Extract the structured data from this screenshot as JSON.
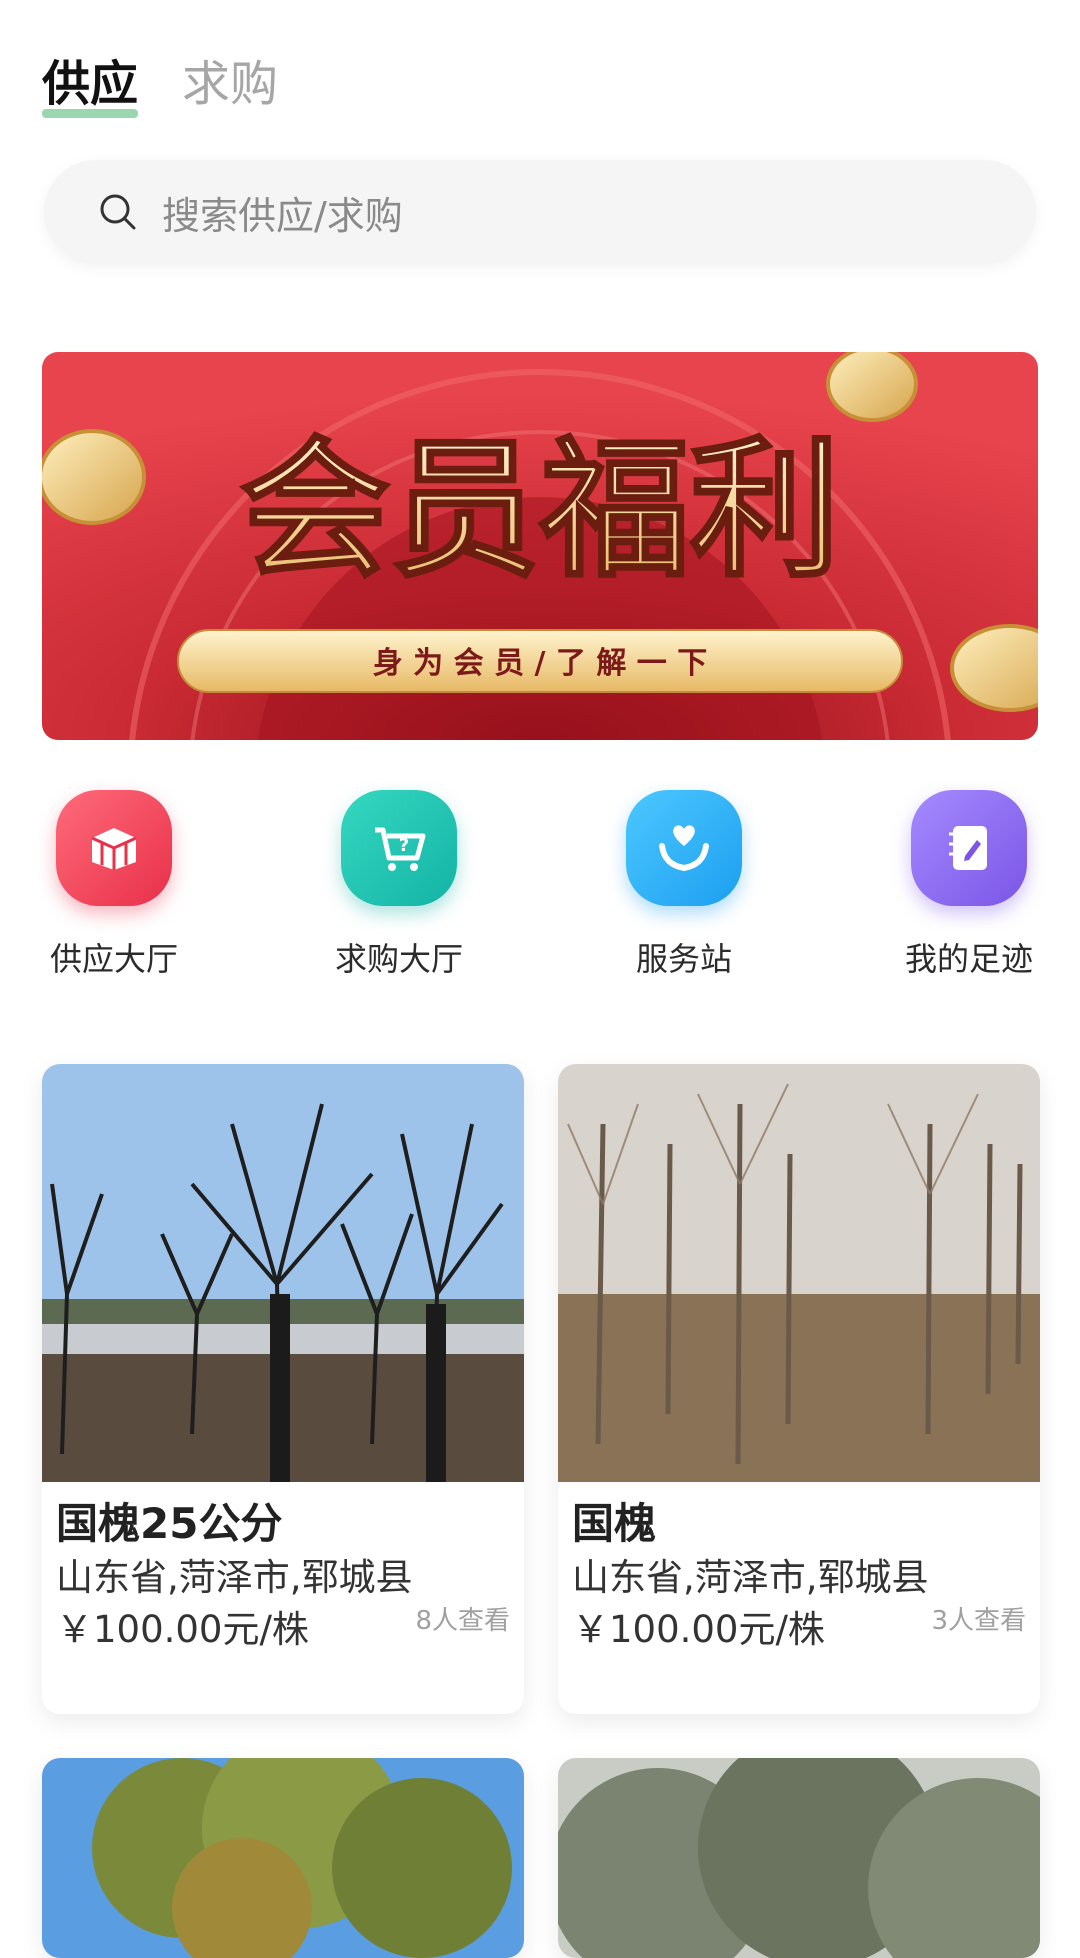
{
  "tabs": [
    {
      "label": "供应",
      "active": true
    },
    {
      "label": "求购",
      "active": false
    }
  ],
  "search": {
    "placeholder": "搜索供应/求购"
  },
  "banner": {
    "title": "会员福利",
    "subtitle": "身 为 会 员 / 了 解 一 下"
  },
  "quick_links": [
    {
      "label": "供应大厅",
      "icon": "supply-hall-icon",
      "color": "#f0485a"
    },
    {
      "label": "求购大厅",
      "icon": "cart-question-icon",
      "color": "#1fc7b0"
    },
    {
      "label": "服务站",
      "icon": "heart-hands-icon",
      "color": "#2fb4f5"
    },
    {
      "label": "我的足迹",
      "icon": "notebook-pen-icon",
      "color": "#8e6cf0"
    }
  ],
  "listings": [
    {
      "title": "国槐25公分",
      "location": "山东省,菏泽市,郓城县",
      "price": "￥100.00元/株",
      "views": "8人查看"
    },
    {
      "title": "国槐",
      "location": "山东省,菏泽市,郓城县",
      "price": "￥100.00元/株",
      "views": "3人查看"
    }
  ]
}
